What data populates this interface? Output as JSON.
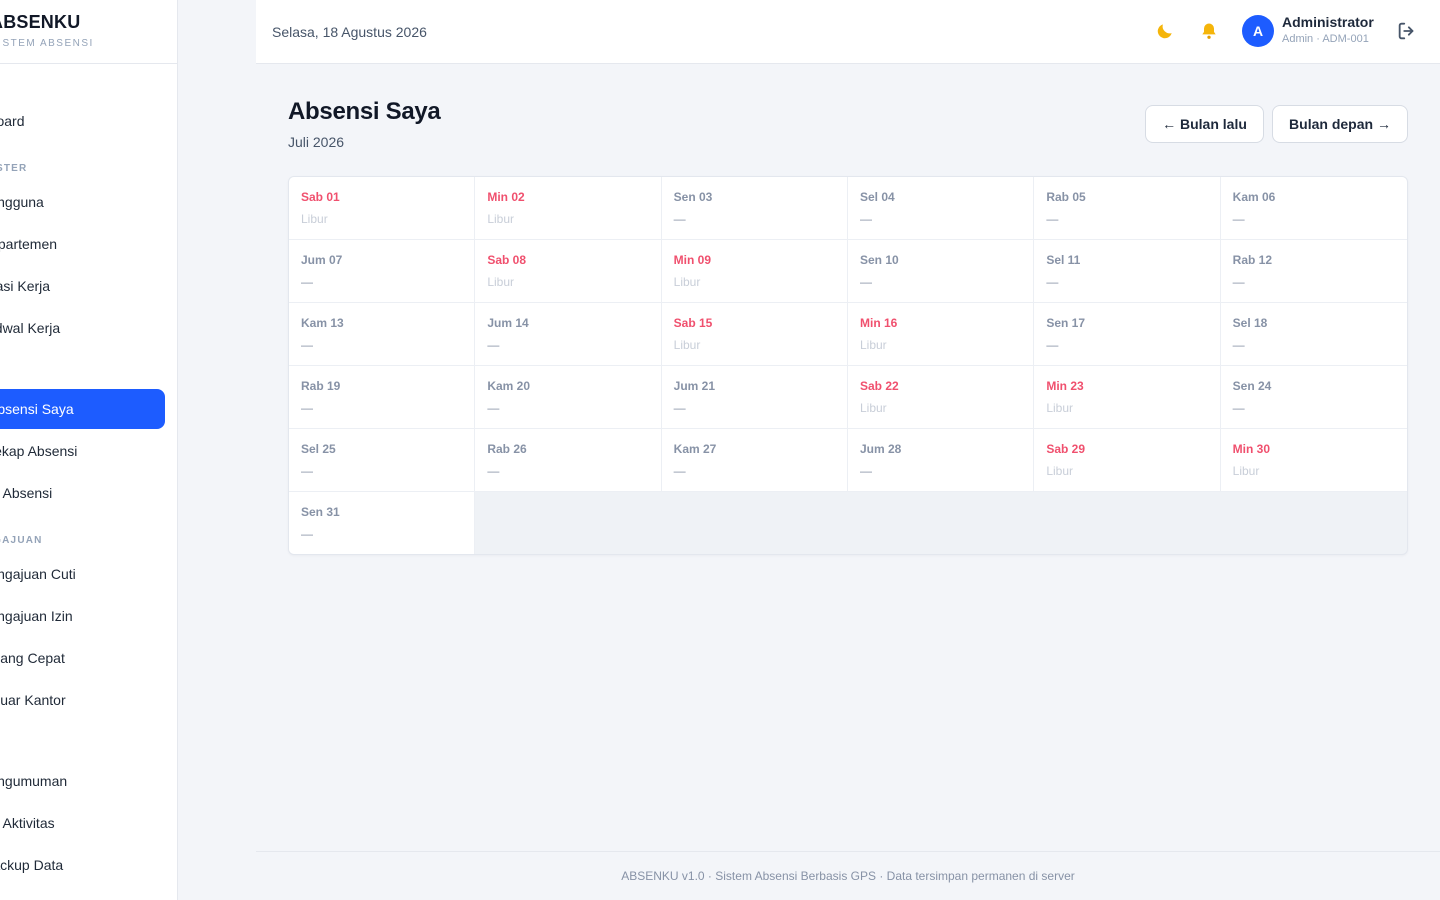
{
  "sidebar": {
    "brand_title": "ABSENKU",
    "brand_subtitle": "SISTEM ABSENSI",
    "items": [
      {
        "label": "Dashboard",
        "visible": "shboard",
        "section": ""
      },
      {
        "label": "Pengguna",
        "visible": "ngguna"
      },
      {
        "label": "Departemen",
        "visible": "partemen"
      },
      {
        "label": "Lokasi Kerja",
        "visible": "asi Kerja"
      },
      {
        "label": "Jadwal Kerja",
        "visible": "wal Kerja"
      },
      {
        "label": "Absensi Saya",
        "visible": "sensi Saya",
        "active": true
      },
      {
        "label": "Rekap Absensi",
        "visible": "kap Absensi"
      },
      {
        "label": "Log Absensi",
        "visible": "Absensi"
      },
      {
        "label": "Pengajuan Cuti",
        "visible": "ngajuan Cuti"
      },
      {
        "label": "Pengajuan Izin",
        "visible": "ngajuan Izin"
      },
      {
        "label": "Pulang Cepat",
        "visible": "ang Cepat"
      },
      {
        "label": "Keluar Kantor",
        "visible": "uar Kantor"
      },
      {
        "label": "Pengumuman",
        "visible": "ngumuman"
      },
      {
        "label": "Log Aktivitas",
        "visible": "Aktivitas"
      },
      {
        "label": "Backup Data",
        "visible": "ckup Data"
      }
    ],
    "sections": [
      "STER",
      "AN"
    ]
  },
  "topbar": {
    "date": "Selasa, 18 Agustus 2026",
    "theme_icon": "moon-icon",
    "notif_icon": "bell-icon",
    "avatar_initial": "A",
    "user_name": "Administrator",
    "user_role": "Admin · ADM-001"
  },
  "main": {
    "title": "Absensi Saya",
    "subtitle": "Juli 2026",
    "prev_button": "← Bulan lalu",
    "next_button": "Bulan depan →"
  },
  "calendar": {
    "days": [
      {
        "label": "Sab 01",
        "status": "Libur",
        "weekend": true
      },
      {
        "label": "Min 02",
        "status": "Libur",
        "weekend": true
      },
      {
        "label": "Sen 03",
        "status": "—",
        "weekend": false
      },
      {
        "label": "Sel 04",
        "status": "—",
        "weekend": false
      },
      {
        "label": "Rab 05",
        "status": "—",
        "weekend": false
      },
      {
        "label": "Kam 06",
        "status": "—",
        "weekend": false
      },
      {
        "label": "Jum 07",
        "status": "—",
        "weekend": false
      },
      {
        "label": "Sab 08",
        "status": "Libur",
        "weekend": true
      },
      {
        "label": "Min 09",
        "status": "Libur",
        "weekend": true
      },
      {
        "label": "Sen 10",
        "status": "—",
        "weekend": false
      },
      {
        "label": "Sel 11",
        "status": "—",
        "weekend": false
      },
      {
        "label": "Rab 12",
        "status": "—",
        "weekend": false
      },
      {
        "label": "Kam 13",
        "status": "—",
        "weekend": false
      },
      {
        "label": "Jum 14",
        "status": "—",
        "weekend": false
      },
      {
        "label": "Sab 15",
        "status": "Libur",
        "weekend": true
      },
      {
        "label": "Min 16",
        "status": "Libur",
        "weekend": true
      },
      {
        "label": "Sen 17",
        "status": "—",
        "weekend": false
      },
      {
        "label": "Sel 18",
        "status": "—",
        "weekend": false
      },
      {
        "label": "Rab 19",
        "status": "—",
        "weekend": false
      },
      {
        "label": "Kam 20",
        "status": "—",
        "weekend": false
      },
      {
        "label": "Jum 21",
        "status": "—",
        "weekend": false
      },
      {
        "label": "Sab 22",
        "status": "Libur",
        "weekend": true
      },
      {
        "label": "Min 23",
        "status": "Libur",
        "weekend": true
      },
      {
        "label": "Sen 24",
        "status": "—",
        "weekend": false
      },
      {
        "label": "Sel 25",
        "status": "—",
        "weekend": false
      },
      {
        "label": "Rab 26",
        "status": "—",
        "weekend": false
      },
      {
        "label": "Kam 27",
        "status": "—",
        "weekend": false
      },
      {
        "label": "Jum 28",
        "status": "—",
        "weekend": false
      },
      {
        "label": "Sab 29",
        "status": "Libur",
        "weekend": true
      },
      {
        "label": "Min 30",
        "status": "Libur",
        "weekend": true
      },
      {
        "label": "Sen 31",
        "status": "—",
        "weekend": false
      }
    ]
  },
  "footer": {
    "text": "ABSENKU v1.0 · Sistem Absensi Berbasis GPS · Data tersimpan permanen di server"
  },
  "colors": {
    "accent": "#1d5cff",
    "weekend": "#f0506e",
    "muted": "#8792a6"
  }
}
